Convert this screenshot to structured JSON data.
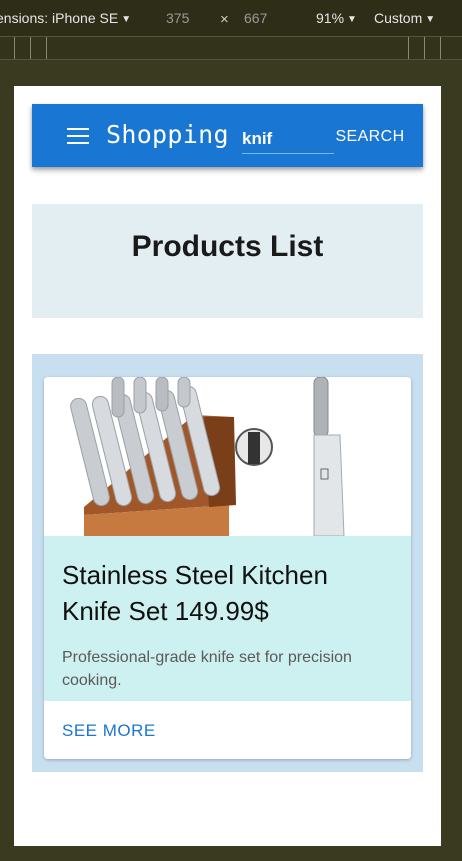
{
  "devtools": {
    "device_label": "ensions: iPhone SE",
    "width": "375",
    "times": "×",
    "height": "667",
    "zoom": "91%",
    "throttle": "Custom"
  },
  "appbar": {
    "title": "Shopping",
    "search_value": "knif",
    "search_button": "SEARCH",
    "color": "#1976d2",
    "menu_icon": "hamburger-menu-icon"
  },
  "page": {
    "title": "Products List"
  },
  "products": [
    {
      "title": "Stainless Steel Kitchen Knife Set 149.99$",
      "description": "Professional-grade knife set for precision cooking.",
      "action": "SEE MORE"
    }
  ]
}
